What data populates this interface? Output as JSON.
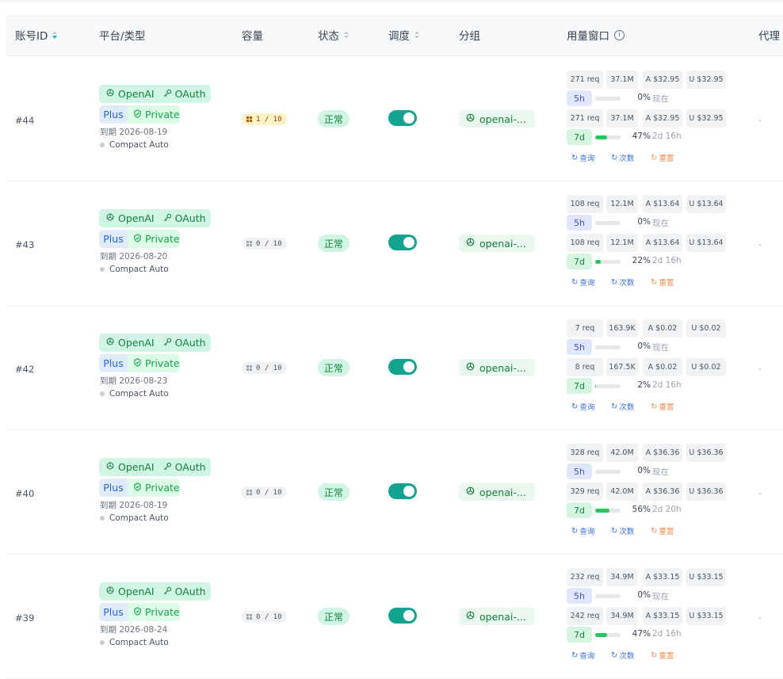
{
  "headers": {
    "id": "账号ID",
    "platform": "平台/类型",
    "capacity": "容量",
    "status": "状态",
    "schedule": "调度",
    "group": "分组",
    "usage": "用量窗口",
    "proxy": "代理"
  },
  "colors": {
    "accent": "#14a38f",
    "status_ok": "#15803d",
    "link": "#3b6fe0",
    "reset": "#f08b4a"
  },
  "rows": [
    {
      "id": "#44",
      "platform": "OpenAI",
      "auth": "OAuth",
      "plan": "Plus",
      "privacy": "Private",
      "expiry": "到期 2026-08-19",
      "compact": "Compact Auto",
      "capacity": "1 / 10",
      "capacity_used": 1,
      "capacity_total": 10,
      "status": "正常",
      "schedule_enabled": true,
      "group": "openai-...",
      "win5h": {
        "req": "271 req",
        "tokens": "37.1M",
        "a": "A $32.95",
        "u": "U $32.95",
        "label": "5h",
        "pct": "0%",
        "reset": "现在",
        "fill": 0
      },
      "win7d": {
        "req": "271 req",
        "tokens": "37.1M",
        "a": "A $32.95",
        "u": "U $32.95",
        "label": "7d",
        "pct": "47%",
        "reset": "2d 16h",
        "fill": 47
      },
      "actions": {
        "query": "查询",
        "count": "次数",
        "reset": "重置"
      },
      "proxy": "-"
    },
    {
      "id": "#43",
      "platform": "OpenAI",
      "auth": "OAuth",
      "plan": "Plus",
      "privacy": "Private",
      "expiry": "到期 2026-08-20",
      "compact": "Compact Auto",
      "capacity": "0 / 10",
      "capacity_used": 0,
      "capacity_total": 10,
      "status": "正常",
      "schedule_enabled": true,
      "group": "openai-...",
      "win5h": {
        "req": "108 req",
        "tokens": "12.1M",
        "a": "A $13.64",
        "u": "U $13.64",
        "label": "5h",
        "pct": "0%",
        "reset": "现在",
        "fill": 0
      },
      "win7d": {
        "req": "108 req",
        "tokens": "12.1M",
        "a": "A $13.64",
        "u": "U $13.64",
        "label": "7d",
        "pct": "22%",
        "reset": "2d 16h",
        "fill": 22
      },
      "actions": {
        "query": "查询",
        "count": "次数",
        "reset": "重置"
      },
      "proxy": "-"
    },
    {
      "id": "#42",
      "platform": "OpenAI",
      "auth": "OAuth",
      "plan": "Plus",
      "privacy": "Private",
      "expiry": "到期 2026-08-23",
      "compact": "Compact Auto",
      "capacity": "0 / 10",
      "capacity_used": 0,
      "capacity_total": 10,
      "status": "正常",
      "schedule_enabled": true,
      "group": "openai-...",
      "win5h": {
        "req": "7 req",
        "tokens": "163.9K",
        "a": "A $0.02",
        "u": "U $0.02",
        "label": "5h",
        "pct": "0%",
        "reset": "现在",
        "fill": 0
      },
      "win7d": {
        "req": "8 req",
        "tokens": "167.5K",
        "a": "A $0.02",
        "u": "U $0.02",
        "label": "7d",
        "pct": "2%",
        "reset": "2d 16h",
        "fill": 2
      },
      "actions": {
        "query": "查询",
        "count": "次数",
        "reset": "重置"
      },
      "proxy": "-"
    },
    {
      "id": "#40",
      "platform": "OpenAI",
      "auth": "OAuth",
      "plan": "Plus",
      "privacy": "Private",
      "expiry": "到期 2026-08-19",
      "compact": "Compact Auto",
      "capacity": "0 / 10",
      "capacity_used": 0,
      "capacity_total": 10,
      "status": "正常",
      "schedule_enabled": true,
      "group": "openai-...",
      "win5h": {
        "req": "328 req",
        "tokens": "42.0M",
        "a": "A $36.36",
        "u": "U $36.36",
        "label": "5h",
        "pct": "0%",
        "reset": "现在",
        "fill": 0
      },
      "win7d": {
        "req": "329 req",
        "tokens": "42.0M",
        "a": "A $36.36",
        "u": "U $36.36",
        "label": "7d",
        "pct": "56%",
        "reset": "2d 20h",
        "fill": 56
      },
      "actions": {
        "query": "查询",
        "count": "次数",
        "reset": "重置"
      },
      "proxy": "-"
    },
    {
      "id": "#39",
      "platform": "OpenAI",
      "auth": "OAuth",
      "plan": "Plus",
      "privacy": "Private",
      "expiry": "到期 2026-08-24",
      "compact": "Compact Auto",
      "capacity": "0 / 10",
      "capacity_used": 0,
      "capacity_total": 10,
      "status": "正常",
      "schedule_enabled": true,
      "group": "openai-...",
      "win5h": {
        "req": "232 req",
        "tokens": "34.9M",
        "a": "A $33.15",
        "u": "U $33.15",
        "label": "5h",
        "pct": "0%",
        "reset": "现在",
        "fill": 0
      },
      "win7d": {
        "req": "242 req",
        "tokens": "34.9M",
        "a": "A $33.15",
        "u": "U $33.15",
        "label": "7d",
        "pct": "47%",
        "reset": "2d 16h",
        "fill": 47
      },
      "actions": {
        "query": "查询",
        "count": "次数",
        "reset": "重置"
      },
      "proxy": "-"
    }
  ]
}
